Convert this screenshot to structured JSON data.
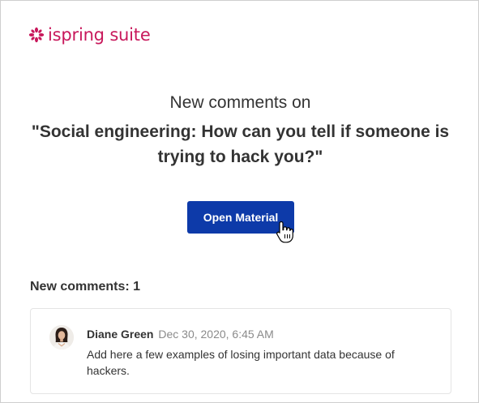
{
  "logo": {
    "brand": "ispring",
    "product": "suite",
    "color": "#c8185b"
  },
  "email": {
    "subtitle": "New comments on",
    "material_title": "\"Social engineering: How can you tell if someone is trying to hack you?\"",
    "open_button_label": "Open Material",
    "comments_count_label": "New comments: 1"
  },
  "comments": [
    {
      "author": "Diane Green",
      "date": "Dec 30, 2020, 6:45 AM",
      "text": "Add here a few examples of losing important data because of hackers."
    }
  ],
  "colors": {
    "button": "#0d3aa9",
    "text": "#333333",
    "muted": "#8a8a8a",
    "border": "#e4e4e4"
  },
  "icons": {
    "cursor": "hand-pointer-icon",
    "logo_mark": "ispring-flower-icon"
  }
}
